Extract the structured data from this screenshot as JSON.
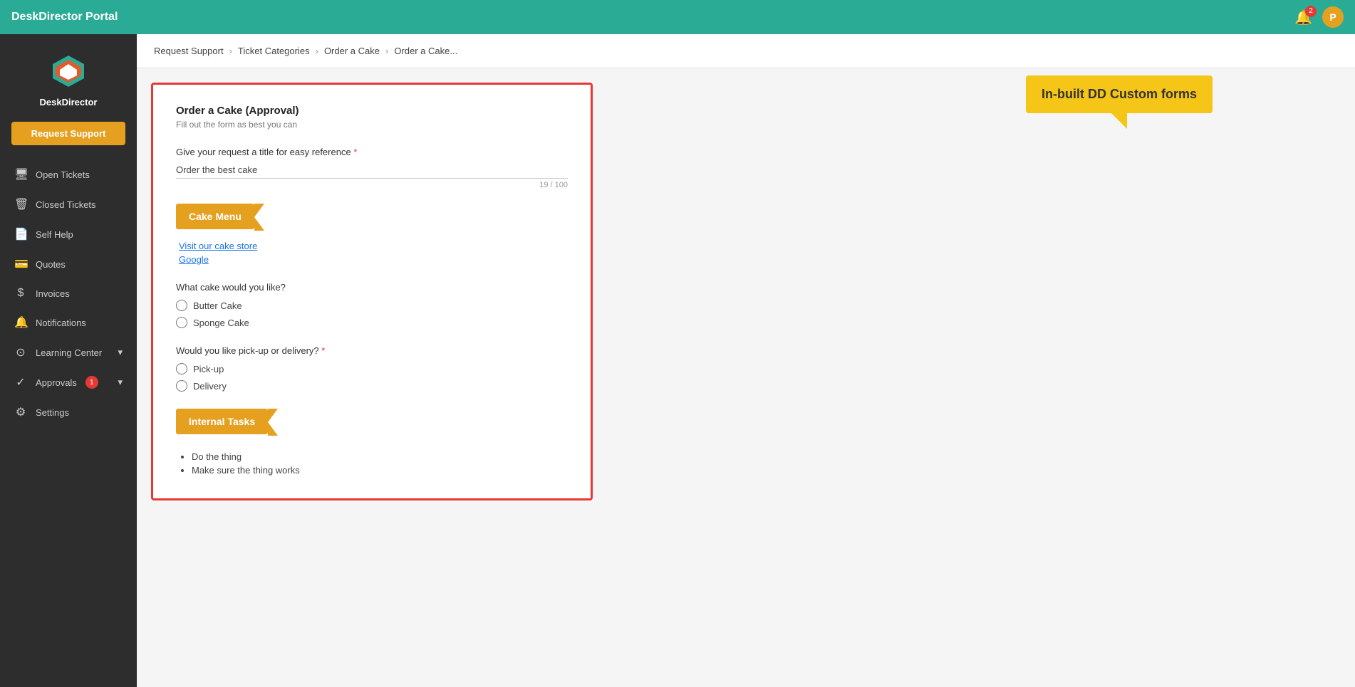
{
  "topbar": {
    "title": "DeskDirector Portal",
    "bell_badge": "2",
    "avatar_label": "P"
  },
  "sidebar": {
    "logo_text": "DeskDirector",
    "request_btn": "Request Support",
    "nav_items": [
      {
        "id": "open-tickets",
        "label": "Open Tickets",
        "icon": "🖥"
      },
      {
        "id": "closed-tickets",
        "label": "Closed Tickets",
        "icon": "🗑"
      },
      {
        "id": "self-help",
        "label": "Self Help",
        "icon": "📄"
      },
      {
        "id": "quotes",
        "label": "Quotes",
        "icon": "💳"
      },
      {
        "id": "invoices",
        "label": "Invoices",
        "icon": "💲"
      },
      {
        "id": "notifications",
        "label": "Notifications",
        "icon": "🔔"
      }
    ],
    "learning_center": {
      "label": "Learning Center",
      "icon": "⊙"
    },
    "approvals": {
      "label": "Approvals",
      "badge": "1"
    },
    "settings": {
      "label": "Settings",
      "icon": "⚙"
    }
  },
  "breadcrumb": {
    "items": [
      {
        "label": "Request Support"
      },
      {
        "label": "Ticket Categories"
      },
      {
        "label": "Order a Cake"
      },
      {
        "label": "Order a Cake..."
      }
    ]
  },
  "callout": {
    "text": "In-built DD Custom forms"
  },
  "form": {
    "title": "Order a Cake (Approval)",
    "subtitle": "Fill out the form as best you can",
    "title_field": {
      "label": "Give your request a title for easy reference",
      "required": true,
      "value": "Order the best cake",
      "counter": "19 / 100"
    },
    "cake_menu": {
      "banner_label": "Cake Menu",
      "links": [
        {
          "label": "Visit our cake store",
          "href": "#"
        },
        {
          "label": "Google",
          "href": "#"
        }
      ]
    },
    "cake_choice": {
      "question": "What cake would you like?",
      "required": false,
      "options": [
        {
          "label": "Butter Cake",
          "value": "butter"
        },
        {
          "label": "Sponge Cake",
          "value": "sponge"
        }
      ]
    },
    "delivery_choice": {
      "question": "Would you like pick-up or delivery?",
      "required": true,
      "options": [
        {
          "label": "Pick-up",
          "value": "pickup"
        },
        {
          "label": "Delivery",
          "value": "delivery"
        }
      ]
    },
    "internal_tasks": {
      "banner_label": "Internal Tasks",
      "tasks": [
        "Do the thing",
        "Make sure the thing works"
      ]
    }
  }
}
